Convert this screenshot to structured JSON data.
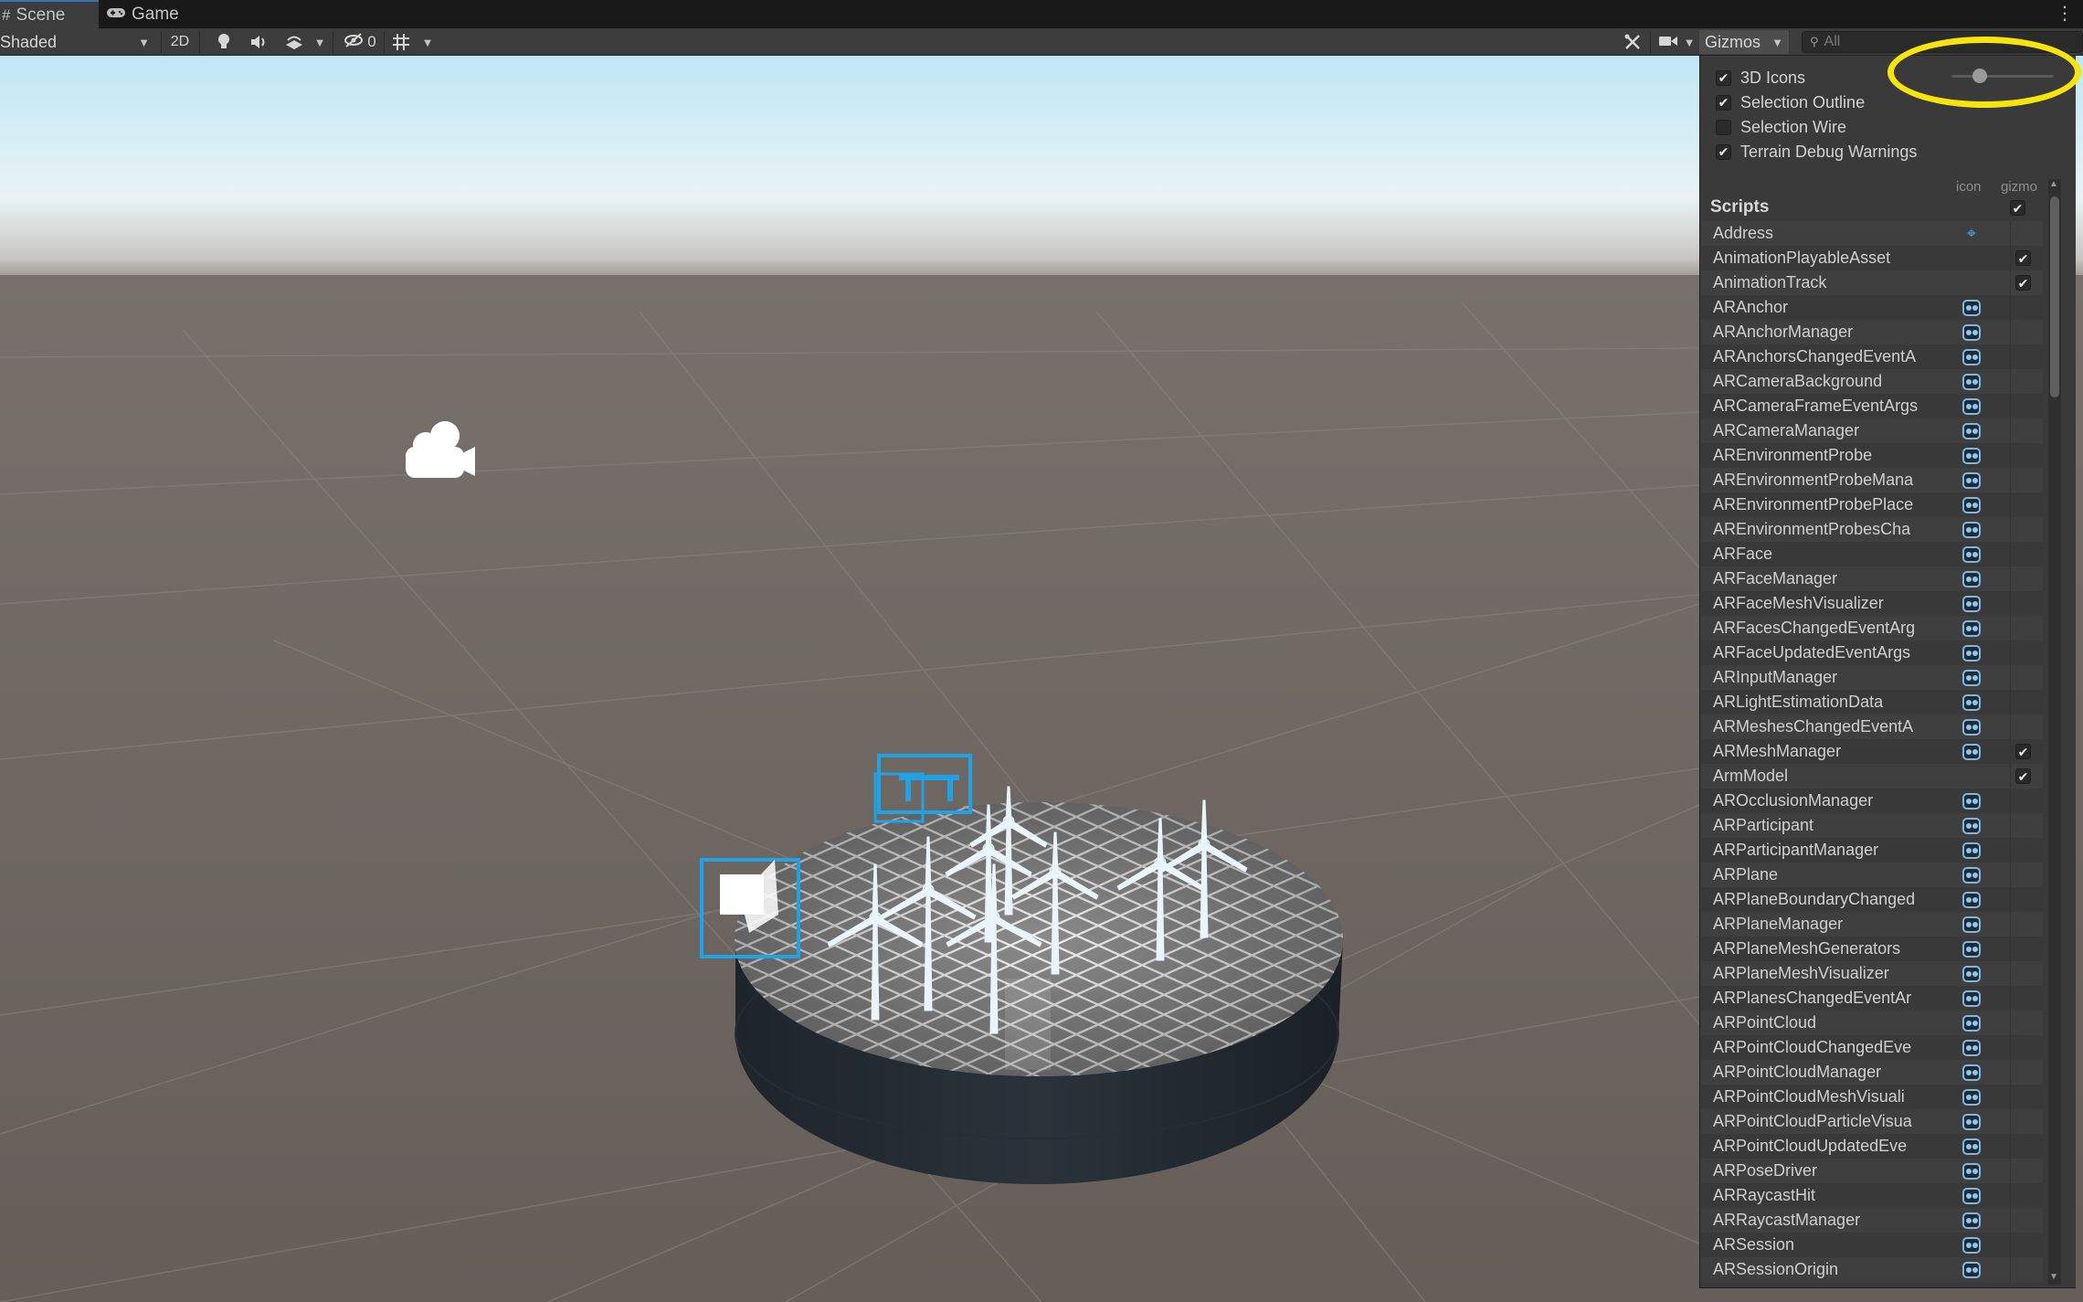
{
  "tabs": [
    {
      "label": "Scene",
      "icon": "grid-icon",
      "glyph": "#"
    },
    {
      "label": "Game",
      "icon": "gamepad-icon",
      "glyph": "🎮"
    }
  ],
  "toolbar": {
    "shading_mode": "Shaded",
    "mode_2d": "2D",
    "hidden_count": "0",
    "gizmos_label": "Gizmos",
    "search_placeholder": "All"
  },
  "gizmo_options": [
    {
      "label": "3D Icons",
      "checked": true
    },
    {
      "label": "Selection Outline",
      "checked": true
    },
    {
      "label": "Selection Wire",
      "checked": false
    },
    {
      "label": "Terrain Debug Warnings",
      "checked": true
    }
  ],
  "icon_size_slider": 0.2,
  "columns": {
    "icon": "icon",
    "gizmo": "gizmo"
  },
  "section": {
    "title": "Scripts",
    "gizmo_checked": true
  },
  "scripts": [
    {
      "name": "Address",
      "icon": "address-icon",
      "gizmo": false
    },
    {
      "name": "AnimationPlayableAsset",
      "icon": "",
      "gizmo": true
    },
    {
      "name": "AnimationTrack",
      "icon": "",
      "gizmo": true
    },
    {
      "name": "ARAnchor",
      "icon": "script-icon",
      "gizmo": false
    },
    {
      "name": "ARAnchorManager",
      "icon": "script-icon",
      "gizmo": false
    },
    {
      "name": "ARAnchorsChangedEventA",
      "icon": "script-icon",
      "gizmo": false
    },
    {
      "name": "ARCameraBackground",
      "icon": "script-icon",
      "gizmo": false
    },
    {
      "name": "ARCameraFrameEventArgs",
      "icon": "script-icon",
      "gizmo": false
    },
    {
      "name": "ARCameraManager",
      "icon": "script-icon",
      "gizmo": false
    },
    {
      "name": "AREnvironmentProbe",
      "icon": "script-icon",
      "gizmo": false
    },
    {
      "name": "AREnvironmentProbeMana",
      "icon": "script-icon",
      "gizmo": false
    },
    {
      "name": "AREnvironmentProbePlace",
      "icon": "script-icon",
      "gizmo": false
    },
    {
      "name": "AREnvironmentProbesCha",
      "icon": "script-icon",
      "gizmo": false
    },
    {
      "name": "ARFace",
      "icon": "script-icon",
      "gizmo": false
    },
    {
      "name": "ARFaceManager",
      "icon": "script-icon",
      "gizmo": false
    },
    {
      "name": "ARFaceMeshVisualizer",
      "icon": "script-icon",
      "gizmo": false
    },
    {
      "name": "ARFacesChangedEventArg",
      "icon": "script-icon",
      "gizmo": false
    },
    {
      "name": "ARFaceUpdatedEventArgs",
      "icon": "script-icon",
      "gizmo": false
    },
    {
      "name": "ARInputManager",
      "icon": "script-icon",
      "gizmo": false
    },
    {
      "name": "ARLightEstimationData",
      "icon": "script-icon",
      "gizmo": false
    },
    {
      "name": "ARMeshesChangedEventA",
      "icon": "script-icon",
      "gizmo": false
    },
    {
      "name": "ARMeshManager",
      "icon": "script-icon",
      "gizmo": true
    },
    {
      "name": "ArmModel",
      "icon": "",
      "gizmo": true
    },
    {
      "name": "AROcclusionManager",
      "icon": "script-icon",
      "gizmo": false
    },
    {
      "name": "ARParticipant",
      "icon": "script-icon",
      "gizmo": false
    },
    {
      "name": "ARParticipantManager",
      "icon": "script-icon",
      "gizmo": false
    },
    {
      "name": "ARPlane",
      "icon": "script-icon",
      "gizmo": false
    },
    {
      "name": "ARPlaneBoundaryChanged",
      "icon": "script-icon",
      "gizmo": false
    },
    {
      "name": "ARPlaneManager",
      "icon": "script-icon",
      "gizmo": false
    },
    {
      "name": "ARPlaneMeshGenerators",
      "icon": "script-icon",
      "gizmo": false
    },
    {
      "name": "ARPlaneMeshVisualizer",
      "icon": "script-icon",
      "gizmo": false
    },
    {
      "name": "ARPlanesChangedEventAr",
      "icon": "script-icon",
      "gizmo": false
    },
    {
      "name": "ARPointCloud",
      "icon": "script-icon",
      "gizmo": false
    },
    {
      "name": "ARPointCloudChangedEve",
      "icon": "script-icon",
      "gizmo": false
    },
    {
      "name": "ARPointCloudManager",
      "icon": "script-icon",
      "gizmo": false
    },
    {
      "name": "ARPointCloudMeshVisuali",
      "icon": "script-icon",
      "gizmo": false
    },
    {
      "name": "ARPointCloudParticleVisua",
      "icon": "script-icon",
      "gizmo": false
    },
    {
      "name": "ARPointCloudUpdatedEve",
      "icon": "script-icon",
      "gizmo": false
    },
    {
      "name": "ARPoseDriver",
      "icon": "script-icon",
      "gizmo": false
    },
    {
      "name": "ARRaycastHit",
      "icon": "script-icon",
      "gizmo": false
    },
    {
      "name": "ARRaycastManager",
      "icon": "script-icon",
      "gizmo": false
    },
    {
      "name": "ARSession",
      "icon": "script-icon",
      "gizmo": false
    },
    {
      "name": "ARSessionOrigin",
      "icon": "script-icon",
      "gizmo": false
    }
  ],
  "colors": {
    "highlight": "#f5e50a",
    "selection": "#1fa3e6",
    "sky_top": "#bfe6f5",
    "ground": "#6b6460"
  }
}
